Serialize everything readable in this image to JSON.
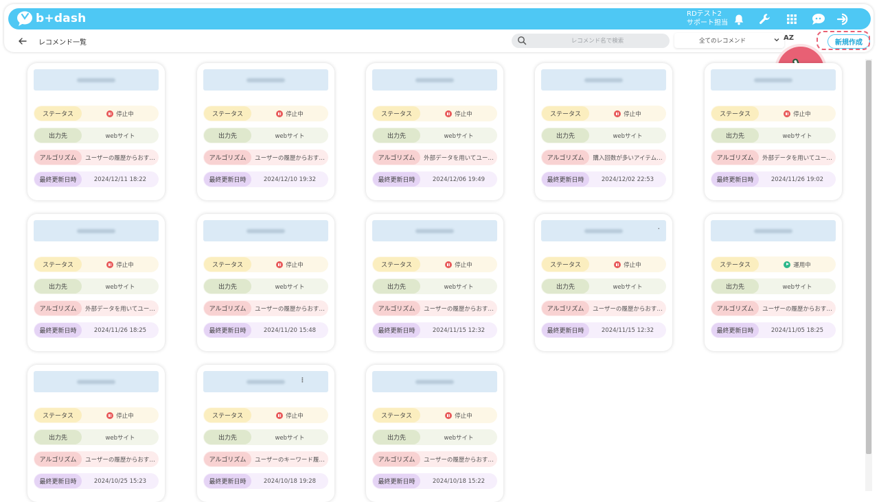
{
  "header": {
    "logo_text": "b+dash",
    "user_line1": "RDテスト2",
    "user_line2": "サポート担当",
    "icons": [
      "bell-icon",
      "wrench-icon",
      "grid-icon",
      "chat-bot-icon",
      "logout-icon"
    ],
    "brand_color": "#4ec8f4"
  },
  "toolbar": {
    "page_title": "レコメンド一覧",
    "search_placeholder": "レコメンド名で検索",
    "filter_value": "全てのレコメンド",
    "sort_label": "AZ",
    "new_button_label": "新規作成"
  },
  "labels": {
    "status": "ステータス",
    "output": "出力先",
    "algorithm": "アルゴリズム",
    "updated": "最終更新日時"
  },
  "cards": [
    {
      "status": "停止中",
      "status_type": "paused",
      "output": "webサイト",
      "algorithm": "ユーザーの履歴からおす…",
      "updated": "2024/12/11 18:22"
    },
    {
      "status": "停止中",
      "status_type": "paused",
      "output": "webサイト",
      "algorithm": "ユーザーの履歴からおす…",
      "updated": "2024/12/10 19:32"
    },
    {
      "status": "停止中",
      "status_type": "paused",
      "output": "webサイト",
      "algorithm": "外部データを用いてユー…",
      "updated": "2024/12/06 19:49"
    },
    {
      "status": "停止中",
      "status_type": "paused",
      "output": "webサイト",
      "algorithm": "購入回数が多いアイテム…",
      "updated": "2024/12/02 22:53"
    },
    {
      "status": "停止中",
      "status_type": "paused",
      "output": "webサイト",
      "algorithm": "外部データを用いてユー…",
      "updated": "2024/11/26 19:02"
    },
    {
      "status": "停止中",
      "status_type": "paused",
      "output": "webサイト",
      "algorithm": "外部データを用いてユー…",
      "updated": "2024/11/26 18:25"
    },
    {
      "status": "停止中",
      "status_type": "paused",
      "output": "webサイト",
      "algorithm": "ユーザーの履歴からおす…",
      "updated": "2024/11/20 15:48"
    },
    {
      "status": "停止中",
      "status_type": "paused",
      "output": "webサイト",
      "algorithm": "ユーザーの履歴からおす…",
      "updated": "2024/11/15 12:32"
    },
    {
      "status": "停止中",
      "status_type": "paused",
      "output": "webサイト",
      "algorithm": "ユーザーの履歴からおす…",
      "updated": "2024/11/15 12:32"
    },
    {
      "status": "運用中",
      "status_type": "running",
      "output": "webサイト",
      "algorithm": "ユーザーの履歴からおす…",
      "updated": "2024/11/05 18:25"
    },
    {
      "status": "停止中",
      "status_type": "paused",
      "output": "webサイト",
      "algorithm": "ユーザーの履歴からおす…",
      "updated": "2024/10/25 15:23"
    },
    {
      "status": "停止中",
      "status_type": "paused",
      "output": "webサイト",
      "algorithm": "ユーザーのキーワード履…",
      "updated": "2024/10/18 19:28"
    },
    {
      "status": "停止中",
      "status_type": "paused",
      "output": "webサイト",
      "algorithm": "ユーザーの履歴からおす…",
      "updated": "2024/10/18 15:22"
    }
  ],
  "colors": {
    "status_paused": "#e85a5a",
    "status_running": "#2eb88a",
    "highlight": "#e86074"
  }
}
